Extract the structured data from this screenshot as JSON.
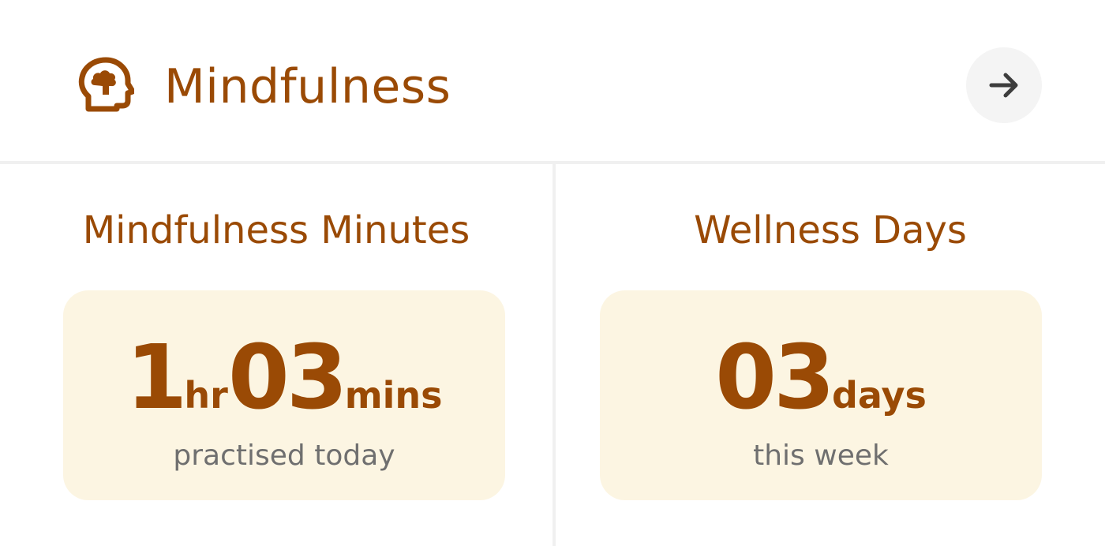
{
  "header": {
    "icon": "mind-head-icon",
    "title": "Mindfulness",
    "action_icon": "arrow-right-icon"
  },
  "minutes_card": {
    "title": "Mindfulness Minutes",
    "hours": "1",
    "hours_unit": "hr",
    "minutes": "03",
    "minutes_unit": "mins",
    "caption": "practised today"
  },
  "days_card": {
    "title": "Wellness Days",
    "days": "03",
    "days_unit": "days",
    "caption": "this week"
  },
  "colors": {
    "accent": "#9a4a05",
    "card_bg": "#fcf5e2",
    "caption": "#6f6f6f",
    "button_bg": "#f4f4f4"
  }
}
